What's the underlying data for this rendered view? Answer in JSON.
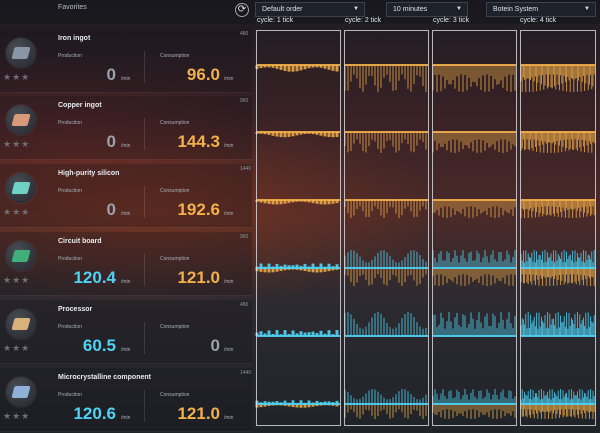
{
  "header": {
    "favorites_label": "Favorites",
    "refresh_icon": "refresh-icon",
    "order_select": "Default order",
    "period_select": "10 minutes",
    "system_select": "Botein System"
  },
  "cycles": [
    "cycle: 1 tick",
    "cycle: 2 tick",
    "cycle: 3 tick",
    "cycle: 4 tick"
  ],
  "colors": {
    "production": "#4fd3f5",
    "consumption": "#f4b04a"
  },
  "items": [
    {
      "name": "Iron ingot",
      "icon": "iron-ingot-icon",
      "icon_color": "#8a96a6",
      "production_label": "Production",
      "production": "0",
      "consumption_label": "Consumption",
      "consumption": "96.0",
      "unit": "/min",
      "axis_max": "480",
      "prod_level": 0,
      "cons_level": 0.45
    },
    {
      "name": "Copper ingot",
      "icon": "copper-ingot-icon",
      "icon_color": "#d99a7c",
      "production_label": "Production",
      "production": "0",
      "consumption_label": "Consumption",
      "consumption": "144.3",
      "unit": "/min",
      "axis_max": "960",
      "prod_level": 0,
      "cons_level": 0.35
    },
    {
      "name": "High-purity silicon",
      "icon": "silicon-icon",
      "icon_color": "#6fd2c6",
      "production_label": "Production",
      "production": "0",
      "consumption_label": "Consumption",
      "consumption": "192.6",
      "unit": "/min",
      "axis_max": "1440",
      "prod_level": 0,
      "cons_level": 0.3
    },
    {
      "name": "Circuit board",
      "icon": "circuit-board-icon",
      "icon_color": "#3fb07a",
      "production_label": "Production",
      "production": "120.4",
      "consumption_label": "Consumption",
      "consumption": "121.0",
      "unit": "/min",
      "axis_max": "960",
      "prod_level": 0.3,
      "cons_level": 0.3
    },
    {
      "name": "Processor",
      "icon": "processor-icon",
      "icon_color": "#d8b27a",
      "production_label": "Production",
      "production": "60.5",
      "consumption_label": "Consumption",
      "consumption": "0",
      "unit": "/min",
      "axis_max": "480",
      "prod_level": 0.4,
      "cons_level": 0
    },
    {
      "name": "Microcrystalline component",
      "icon": "microcrystalline-icon",
      "icon_color": "#8fb0d8",
      "production_label": "Production",
      "production": "120.6",
      "consumption_label": "Consumption",
      "consumption": "121.0",
      "unit": "/min",
      "axis_max": "1440",
      "prod_level": 0.25,
      "cons_level": 0.25
    }
  ]
}
